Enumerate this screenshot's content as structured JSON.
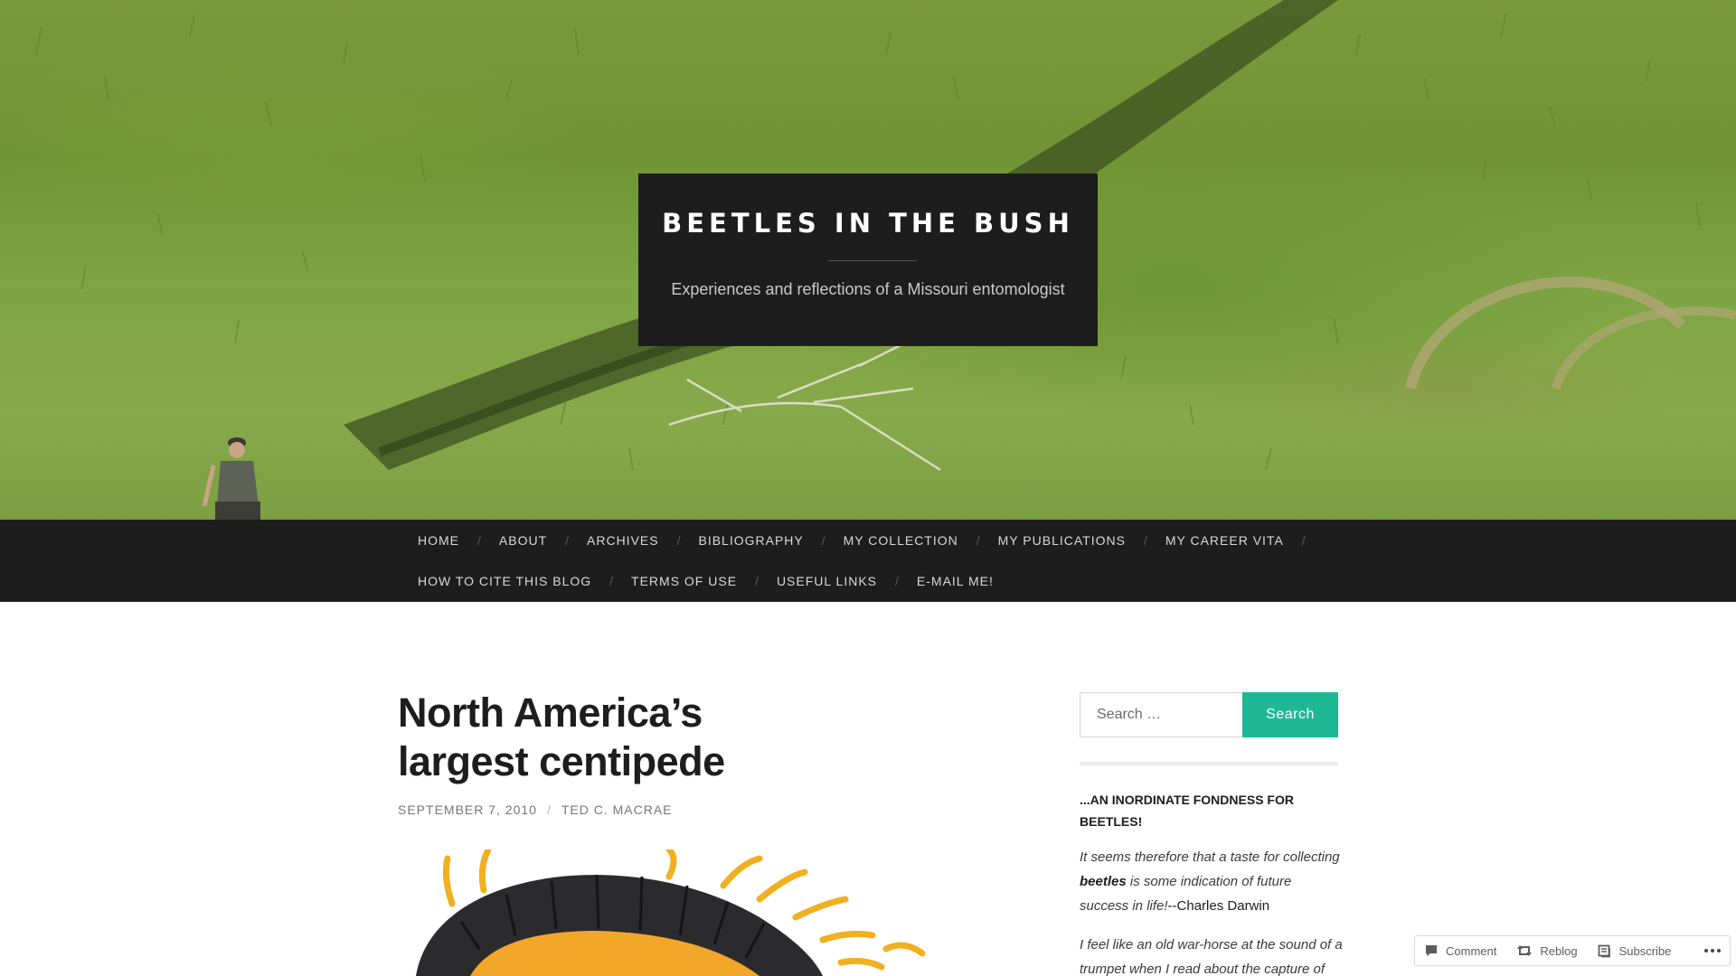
{
  "site": {
    "title": "BEETLES IN THE BUSH",
    "tagline": "Experiences and reflections of a Missouri entomologist"
  },
  "nav": {
    "row1": [
      "HOME",
      "ABOUT",
      "ARCHIVES",
      "BIBLIOGRAPHY",
      "MY COLLECTION",
      "MY PUBLICATIONS",
      "MY CAREER VITA"
    ],
    "row2": [
      "HOW TO CITE THIS BLOG",
      "TERMS OF USE",
      "USEFUL LINKS",
      "E-MAIL ME!"
    ]
  },
  "post": {
    "title_line1": "North America’s",
    "title_line2": "largest centipede",
    "date": "SEPTEMBER 7, 2010",
    "author": "TED C. MACRAE"
  },
  "sidebar": {
    "search": {
      "placeholder": "Search …",
      "button_label": "Search"
    },
    "widget": {
      "title": "...AN INORDINATE FONDNESS FOR BEETLES!",
      "quote1_a": "It seems therefore that a taste for collecting",
      "quote1_bold": "beetles",
      "quote1_b": "is some indication of future success in life!",
      "quote1_attrib": "--Charles Darwin",
      "quote2": "I feel like an old war-horse at the sound of a trumpet when I read about the capture of"
    }
  },
  "action_bar": {
    "comment_label": "Comment",
    "reblog_label": "Reblog",
    "subscribe_label": "Subscribe"
  },
  "colors": {
    "header_bg": "#1d1d1e",
    "accent": "#1fb894"
  }
}
